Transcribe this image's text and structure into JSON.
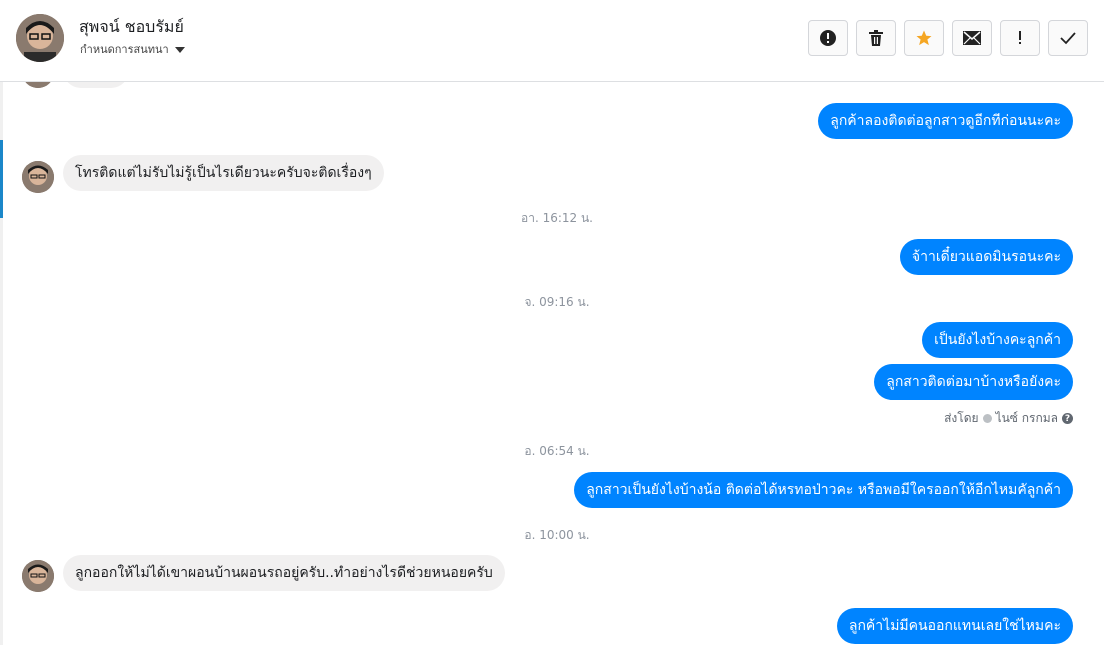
{
  "header": {
    "contact_name": "สุพจน์ ชอบรัมย์",
    "subtitle": "กำหนดการสนทนา",
    "toolbar": [
      {
        "name": "report-button",
        "icon": "alert-circle-icon"
      },
      {
        "name": "delete-button",
        "icon": "trash-icon"
      },
      {
        "name": "star-button",
        "icon": "star-icon"
      },
      {
        "name": "mail-button",
        "icon": "envelope-icon"
      },
      {
        "name": "important-button",
        "icon": "exclamation-icon"
      },
      {
        "name": "done-button",
        "icon": "checkmark-icon"
      }
    ],
    "star_color": "#f5a623"
  },
  "messages": {
    "m1": "ลูกค้าลองติดต่อลูกสาวดูอีกทีก่อนนะคะ",
    "m2": "โทรติดแต่ไม่รับไม่รู้เป็นไรเดียวนะครับจะติดเรื่องๆ",
    "t1": "อา. 16:12 น.",
    "m3": "จ้าาเดี๋ยวแอดมินรอนะคะ",
    "t2": "จ. 09:16 น.",
    "m4": "เป็นยังไงบ้างคะลูกค้า",
    "m5": "ลูกสาวติดต่อมาบ้างหรือยังคะ",
    "sent_by_label": "ส่งโดย",
    "sent_by_name": "ไนซ์ กรกมล",
    "t3": "อ. 06:54 น.",
    "m6": "ลูกสาวเป็นยังไงบ้างน้อ ติดต่อได้หรทอป่าวคะ หรือพอมีใครออกให้อีกไหมคัลูกค้า",
    "t4": "อ. 10:00 น.",
    "m7": "ลูกออกให้ไม่ได้เขาผอนบ้านผอนรถอยู่ครับ..ทำอย่างไรดีช่วยหนอยครับ",
    "m8": "ลูกค้าไม่มีคนออกแทนเลยใช่ไหมคะ"
  },
  "colors": {
    "outgoing_bubble": "#0084ff",
    "incoming_bubble": "#f1f0f0",
    "active_rail": "#1b87c9"
  }
}
